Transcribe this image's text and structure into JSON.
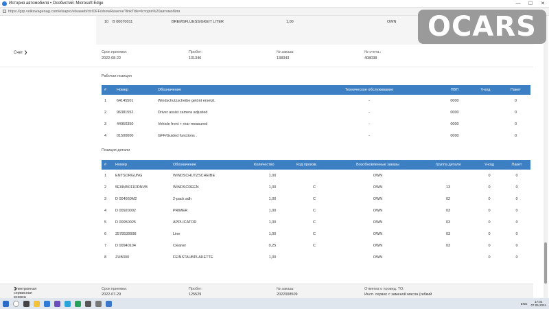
{
  "window": {
    "title": "История автомобиля • Особистий: Microsoft Edge"
  },
  "address": {
    "url": "https://grp.volkswagenag.com/elsapro/elsaweb/ctr/DFF/showReserve?linkTitle=Історія%20автомобіля"
  },
  "prev_row": {
    "num": "10",
    "code": "B 00070011",
    "name": "BREMSFLUESSIGKEIT LITER",
    "qty": "1,00",
    "status": "OWN"
  },
  "summary": {
    "toggle": "Счет",
    "received_label": "Срок приемки:",
    "received": "2022-08-22",
    "mileage_label": "Пробег:",
    "mileage": "131346",
    "order_label": "№ заказа:",
    "order": "138343",
    "invoice_label": "№ счета.:",
    "invoice": "408038"
  },
  "work_section": {
    "title": "Рабочая позиция"
  },
  "work_table": {
    "headers": [
      "#",
      "Номер",
      "Обозначение",
      "Техническое обслуживание",
      "ПВП",
      "V-код",
      "Пакет"
    ],
    "rows": [
      [
        "1",
        "64145501",
        "Windschutzscheibe getönt ersetzt.",
        "-",
        "0000",
        "",
        "0"
      ],
      [
        "2",
        "96381552",
        "Driver assist camera adjusted",
        "-",
        "0000",
        "",
        "0"
      ],
      [
        "3",
        "44950350",
        "Vehicle front + rear measured",
        "-",
        "0000",
        "",
        "0"
      ],
      [
        "4",
        "01500000",
        "GFF/Guided functions .",
        "-",
        "0000",
        "",
        "0"
      ]
    ]
  },
  "parts_section": {
    "title": "Позиция детали"
  },
  "parts_table": {
    "headers": [
      "#",
      "Номер",
      "Обозначение",
      "Количество",
      "Код произв.",
      "Возобновленные заказы",
      "Группа детали",
      "V-код",
      "Пакет"
    ],
    "rows": [
      [
        "1",
        "ENTSORGUNG",
        "WINDSCHUTZSCHEIBE",
        "1,00",
        "",
        "OWN",
        "",
        "0",
        "0"
      ],
      [
        "2",
        "5E0845011DDNVB",
        "WINDSCREEN",
        "1,00",
        "C",
        "OWN",
        "13",
        "0",
        "0"
      ],
      [
        "3",
        "D 004660M2",
        "2-pack adh",
        "1,00",
        "C",
        "OWN",
        "02",
        "0",
        "0"
      ],
      [
        "4",
        "D 00920002",
        "PRIMER",
        "1,00",
        "C",
        "OWN",
        "03",
        "0",
        "0"
      ],
      [
        "5",
        "D 00950025",
        "APPLICATOR",
        "1,00",
        "C",
        "OWN",
        "03",
        "0",
        "0"
      ],
      [
        "6",
        "3578539998",
        "Line",
        "1,00",
        "C",
        "OWN",
        "03",
        "0",
        "0"
      ],
      [
        "7",
        "D 00940104",
        "Cleaner",
        "0,25",
        "C",
        "OWN",
        "03",
        "0",
        "0"
      ],
      [
        "8",
        "ZUB300",
        "FEINSTAUBPLAKETTE",
        "1,00",
        "",
        "OWN",
        "",
        "0",
        "0"
      ]
    ]
  },
  "bottom": {
    "toggle": "Электронная сервисная книжка",
    "received_label": "Срок приемки:",
    "received": "2022-07-29",
    "mileage_label": "Пробег:",
    "mileage": "125529",
    "order_label": "№ заказа:",
    "order": "2022008509",
    "service_label": "Отметка о провед. ТО:",
    "service": "Инсп. сервис с заменой масла (гибкий"
  },
  "tray": {
    "lang": "ENG",
    "time": "17:02",
    "date": "07.05.2024"
  },
  "watermark": {
    "text": "OCARS"
  },
  "colors": {
    "header_blue": "#3d7fc3",
    "watermark_gray": "#9a9a9a"
  },
  "icons": [
    "edge-icon",
    "chevron-down-icon",
    "chevron-right-icon",
    "windows-start-icon",
    "search-icon"
  ]
}
